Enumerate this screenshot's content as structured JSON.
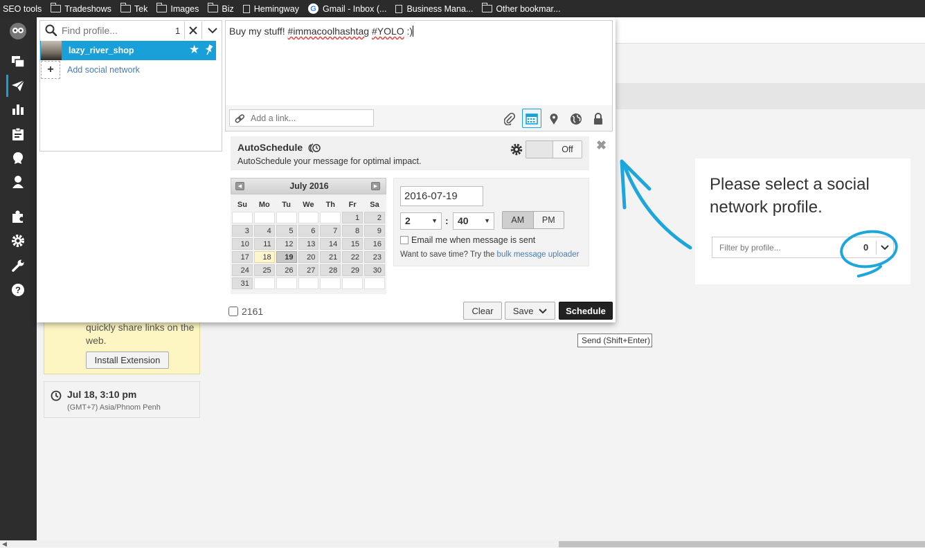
{
  "bookmarks": [
    {
      "label": "SEO tools",
      "icon": "none"
    },
    {
      "label": "Tradeshows",
      "icon": "folder-icon"
    },
    {
      "label": "Tek",
      "icon": "folder-icon"
    },
    {
      "label": "Images",
      "icon": "folder-icon"
    },
    {
      "label": "Biz",
      "icon": "folder-icon"
    },
    {
      "label": "Hemingway",
      "icon": "page-icon"
    },
    {
      "label": "Gmail - Inbox (...",
      "icon": "google-icon"
    },
    {
      "label": "Business Mana...",
      "icon": "page-icon"
    },
    {
      "label": "Other bookmar...",
      "icon": "folder-icon"
    }
  ],
  "nav_icons": [
    "owl-logo-icon",
    "streams-icon",
    "publisher-icon",
    "analytics-icon",
    "assignments-icon",
    "campaigns-icon",
    "contacts-icon",
    "apps-icon",
    "settings-icon",
    "tools-icon",
    "help-icon"
  ],
  "profiles": {
    "search_placeholder": "Find profile...",
    "selected_count": "1",
    "items": [
      {
        "name": "lazy_river_shop"
      }
    ],
    "add_label": "Add social network"
  },
  "message": {
    "prefix": "Buy my stuff! ",
    "hashtag1": "#immacoolhashtag",
    "middle": " ",
    "hashtag2": "#YOLO",
    "suffix": " :)",
    "link_placeholder": "Add a link..."
  },
  "autoschedule": {
    "title": "AutoSchedule",
    "subtitle": "AutoSchedule your message for optimal impact.",
    "toggle_state": "Off"
  },
  "calendar": {
    "month_label": "July 2016",
    "weekdays": [
      "Su",
      "Mo",
      "Tu",
      "We",
      "Th",
      "Fr",
      "Sa"
    ],
    "weeks": [
      [
        "",
        "",
        "",
        "",
        "",
        "1",
        "2"
      ],
      [
        "3",
        "4",
        "5",
        "6",
        "7",
        "8",
        "9"
      ],
      [
        "10",
        "11",
        "12",
        "13",
        "14",
        "15",
        "16"
      ],
      [
        "17",
        "18",
        "19",
        "20",
        "21",
        "22",
        "23"
      ],
      [
        "24",
        "25",
        "26",
        "27",
        "28",
        "29",
        "30"
      ],
      [
        "31",
        "",
        "",
        "",
        "",
        "",
        ""
      ]
    ],
    "today": "18",
    "selected": "19"
  },
  "schedule": {
    "date": "2016-07-19",
    "hour": "2",
    "minute": "40",
    "am_label": "AM",
    "pm_label": "PM",
    "email_label": "Email me when message is sent",
    "save_time_text": "Want to save time? Try the ",
    "bulk_link": "bulk message uploader"
  },
  "footer": {
    "char_count": "2161",
    "clear_label": "Clear",
    "save_label": "Save",
    "schedule_label": "Schedule",
    "tooltip": "Send (Shift+Enter)"
  },
  "background": {
    "select_prompt": "Please select a social network profile.",
    "filter_placeholder": "Filter by profile...",
    "filter_count": "0",
    "extension_text": "quickly share links on the web.",
    "install_label": "Install Extension",
    "time_main": "Jul 18, 3:10 pm",
    "time_zone": "(GMT+7) Asia/Phnom Penh"
  },
  "colors": {
    "accent": "#1aa0d8",
    "annotation": "#1da6dc",
    "nav_bg": "#2d2d2d"
  }
}
